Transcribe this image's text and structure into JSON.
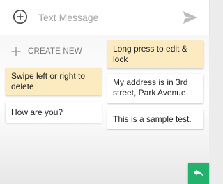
{
  "compose": {
    "add_icon": "plus-circle-icon",
    "placeholder": "Text Message",
    "value": "",
    "send_icon": "send-icon"
  },
  "create_new": {
    "icon": "plus-icon",
    "label": "CREATE NEW"
  },
  "notes": [
    {
      "text": "Long press to edit & lock",
      "color": "#fcebc0"
    },
    {
      "text": "Swipe left or right to delete",
      "color": "#fcebc0"
    },
    {
      "text": "My address is in 3rd street,  Park Avenue",
      "color": "#ffffff"
    },
    {
      "text": "How are you?",
      "color": "#ffffff"
    },
    {
      "text": "This is a sample test.",
      "color": "#ffffff"
    }
  ],
  "fab": {
    "icon": "reply-icon",
    "color": "#22b26d"
  }
}
